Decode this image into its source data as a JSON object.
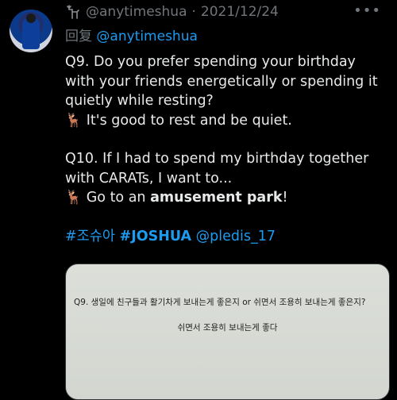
{
  "tweet": {
    "handle": "@anytimeshua",
    "separator": "·",
    "date": "2021/12/24",
    "more_icon": "more-horizontal-icon",
    "reply_prefix": "回复",
    "reply_mention": "@anytimeshua",
    "lines": {
      "q9": "Q9. Do you prefer spending your birthday with your friends energetically or spending it quietly while resting?",
      "a9": " It's good to rest and be quiet.",
      "q10": "Q10. If I had to spend my birthday together with CARATs, I want to...",
      "a10_pre": " Go to an ",
      "a10_bold": "amusement park",
      "a10_post": "!",
      "deer": "🦌"
    },
    "tags": {
      "tag1": "#조슈아",
      "tag2": "#JOSHUA",
      "mention": "@pledis_17"
    },
    "media": {
      "question": "Q9. 생일에 친구들과 활기차게 보내는게 좋은지 or 쉬면서 조용히 보내는게 좋은지?",
      "answer": "쉬면서 조용히 보내는게 좋다"
    }
  },
  "colors": {
    "background": "#000000",
    "text": "#e7e9ea",
    "muted": "#71767b",
    "accent": "#1d9bf0"
  }
}
